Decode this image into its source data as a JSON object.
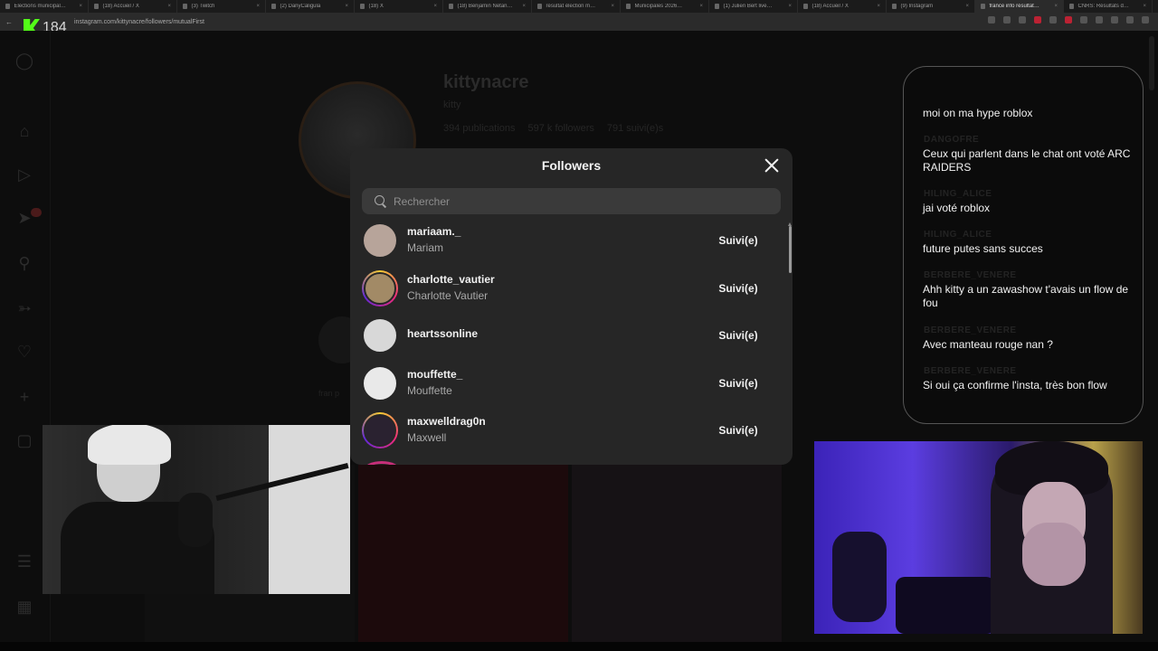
{
  "browser": {
    "tabs": [
      {
        "label": "Elections municipal…",
        "active": false
      },
      {
        "label": "(18) Accueil / X",
        "active": false
      },
      {
        "label": "(3) Twitch",
        "active": false
      },
      {
        "label": "(2) DanyCaligula",
        "active": false
      },
      {
        "label": "(18) X",
        "active": false
      },
      {
        "label": "(18) Benjamin Netan…",
        "active": false
      },
      {
        "label": "résultat élection m…",
        "active": false
      },
      {
        "label": "Municipales 2026…",
        "active": false
      },
      {
        "label": "(1) Julien Bert live…",
        "active": false
      },
      {
        "label": "(18) Accueil / X",
        "active": false
      },
      {
        "label": "(9) Instagram",
        "active": false
      },
      {
        "label": "france info résultat…",
        "active": true
      },
      {
        "label": "CNRS: Résultats d…",
        "active": false
      }
    ],
    "url": "instagram.com/kittynacre/followers/mutualFirst"
  },
  "stream": {
    "badge_number": "184"
  },
  "profile": {
    "username": "kittynacre",
    "display_name": "kitty",
    "stats": [
      "394 publications",
      "597 k followers",
      "791 suivi(e)s"
    ],
    "highlight_label": "fran p"
  },
  "modal": {
    "title": "Followers",
    "search_placeholder": "Rechercher",
    "follow_label": "Suivi(e)",
    "followers": [
      {
        "username": "mariaam._",
        "name": "Mariam",
        "story_ring": false,
        "avatar_color": "#b7a49a"
      },
      {
        "username": "charlotte_vautier",
        "name": "Charlotte Vautier",
        "story_ring": true,
        "avatar_color": "#a28a66"
      },
      {
        "username": "heartssonline",
        "name": "",
        "story_ring": false,
        "avatar_color": "#d8d8d8"
      },
      {
        "username": "mouffette_",
        "name": "Mouffette",
        "story_ring": false,
        "avatar_color": "#e9e9e9"
      },
      {
        "username": "maxwelldrag0n",
        "name": "Maxwell",
        "story_ring": true,
        "avatar_color": "#2a2230"
      }
    ]
  },
  "chat": {
    "messages": [
      {
        "author": "",
        "text": "moi on ma hype roblox"
      },
      {
        "author": "DANGOFRE",
        "text": "Ceux qui parlent dans le chat ont voté ARC RAIDERS"
      },
      {
        "author": "HILING_ALICE",
        "text": "jai voté roblox"
      },
      {
        "author": "HILING_ALICE",
        "text": "future putes sans succes"
      },
      {
        "author": "BERBERE_VENERE",
        "text": "Ahh kitty a un zawashow t'avais un flow de fou"
      },
      {
        "author": "BERBERE_VENERE",
        "text": "Avec manteau rouge nan ?"
      },
      {
        "author": "BERBERE_VENERE",
        "text": "Si oui ça confirme l'insta, très bon flow"
      }
    ]
  },
  "colors": {
    "modal_bg": "#262626",
    "kick_green": "#53fc18",
    "story_ring": "#ee2a7b"
  },
  "icons": {
    "sidebar": [
      "instagram-icon",
      "home-icon",
      "reels-icon",
      "messages-icon",
      "search-icon",
      "explore-icon",
      "heart-icon",
      "create-icon",
      "profile-icon",
      "menu-icon",
      "apps-icon"
    ]
  }
}
